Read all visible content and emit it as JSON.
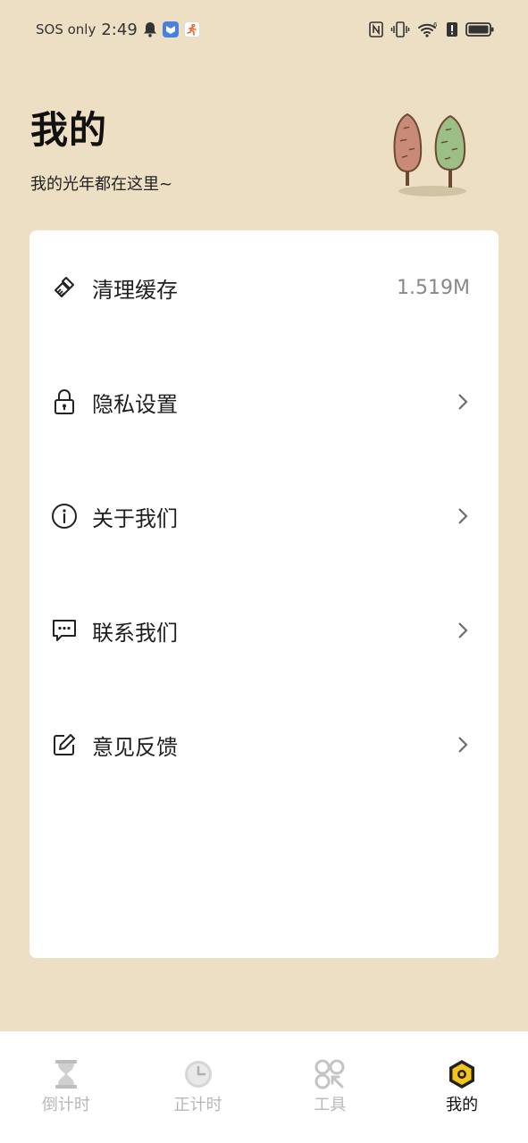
{
  "status_bar": {
    "carrier": "SOS only",
    "time": "2:49",
    "network": "6"
  },
  "header": {
    "title": "我的",
    "subtitle": "我的光年都在这里~"
  },
  "menu": {
    "items": [
      {
        "label": "清理缓存",
        "value": "1.519M",
        "icon": "broom-icon"
      },
      {
        "label": "隐私设置",
        "icon": "lock-icon"
      },
      {
        "label": "关于我们",
        "icon": "info-icon"
      },
      {
        "label": "联系我们",
        "icon": "chat-icon"
      },
      {
        "label": "意见反馈",
        "icon": "edit-icon"
      }
    ]
  },
  "tabs": [
    {
      "label": "倒计时",
      "icon": "hourglass-icon",
      "active": false
    },
    {
      "label": "正计时",
      "icon": "clock-icon",
      "active": false
    },
    {
      "label": "工具",
      "icon": "tools-icon",
      "active": false
    },
    {
      "label": "我的",
      "icon": "profile-icon",
      "active": true
    }
  ],
  "colors": {
    "background": "#eddfc4",
    "card": "#ffffff",
    "tab_active": "#111111",
    "tab_inactive": "#b8b8b8",
    "accent_yellow": "#f5c518"
  }
}
